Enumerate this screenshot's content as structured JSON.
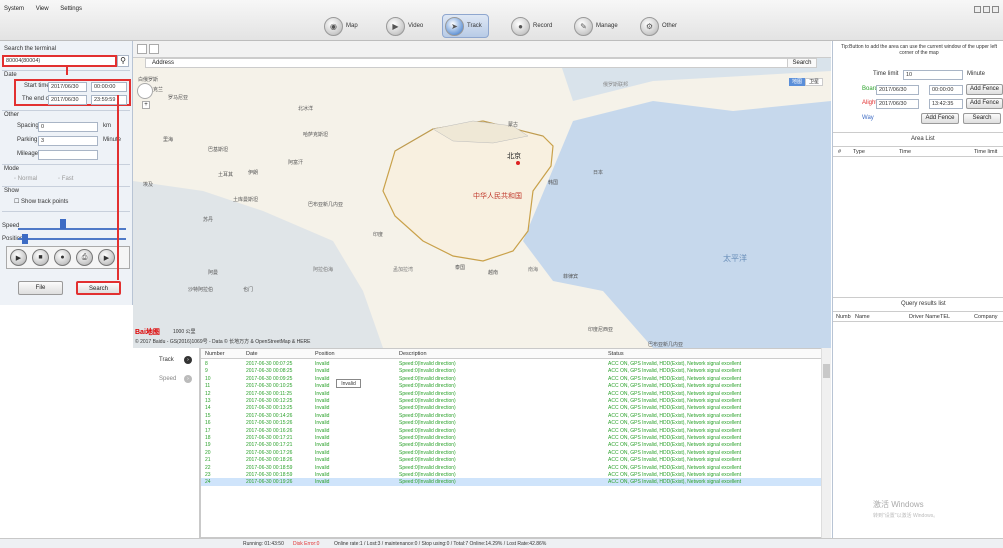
{
  "menu": [
    "System",
    "View",
    "Settings"
  ],
  "nav": {
    "map": "Map",
    "video": "Video",
    "track": "Track",
    "record": "Record",
    "manage": "Manage",
    "other": "Other"
  },
  "left": {
    "search_title": "Search the terminal",
    "terminal_value": "80004(80004)",
    "date_label": "Date",
    "start_label": "Start time",
    "start_date": "2017/06/30",
    "start_time": "00:00:00",
    "end_label": "The end of",
    "end_date": "2017/06/30",
    "end_time": "23:59:59",
    "other_label": "Other",
    "spacing_label": "Spacing",
    "spacing_value": "0",
    "spacing_unit": "km",
    "parking_label": "Parking",
    "parking_value": "3",
    "parking_unit": "Minute",
    "mileage_label": "Mileage",
    "mode_label": "Mode",
    "mode_normal": "Normal",
    "mode_fast": "Fast",
    "show_label": "Show",
    "show_track": "Show track points",
    "speed_label": "Speed",
    "position_label": "Position",
    "file_btn": "File",
    "search_btn": "Search"
  },
  "map": {
    "address_label": "Address",
    "search_label": "Search",
    "copyright": "© 2017 Baidu - GS(2016)1069号 - Data © 长地万方 & OpenStreetMap & HERE",
    "beijing": "北京",
    "china": "中华人民共和国",
    "pacific": "太平洋",
    "labels": [
      "俄罗斯联邦",
      "蒙古",
      "哈萨克斯坦",
      "日本",
      "韩国",
      "印度",
      "泰国",
      "越南",
      "菲律宾",
      "孟加拉湾",
      "南海",
      "印度尼西亚",
      "巴布亚新几内亚",
      "阿富汗",
      "巴基斯坦",
      "伊朗",
      "土耳其",
      "土库曼斯坦",
      "乌兹别克斯坦",
      "阿曼",
      "也门",
      "沙特阿拉伯",
      "阿联酋",
      "埃及",
      "苏丹",
      "埃塞俄比亚",
      "索马里",
      "肯尼亚",
      "白俄罗斯",
      "乌克兰",
      "罗马尼亚",
      "北冰洋",
      "里海",
      "阿拉伯海"
    ],
    "satellite": "卫星",
    "map_btn": "地图",
    "baidu_logo": "Bai地图",
    "scale": "1000 公里"
  },
  "right": {
    "tip": "Tip:Button to add the area can use the current window of the upper left corner of the map",
    "time_limit_label": "Time limit",
    "time_limit_value": "10",
    "time_limit_unit": "Minute",
    "board_label": "Board",
    "board_date": "2017/06/30",
    "board_time": "00:00:00",
    "alight_label": "Alight",
    "alight_date": "2017/06/30",
    "alight_time": "13:42:35",
    "add_fence_1": "Add Fence",
    "add_fence_2": "Add Fence",
    "way_label": "Way",
    "add_fence_3": "Add Fence",
    "search_btn": "Search",
    "area_list": "Area List",
    "area_cols": [
      "#",
      "Type",
      "Time",
      "Time limit"
    ],
    "query_title": "Query results list",
    "query_cols": [
      "Numb",
      "Name",
      "Driver Name",
      "TEL",
      "Company"
    ],
    "watermark_1": "激活 Windows",
    "watermark_2": "转到\"设置\"以激活 Windows。"
  },
  "tabs": {
    "track": "Track",
    "speed": "Speed"
  },
  "grid": {
    "cols": [
      "Number",
      "Date",
      "Position",
      "Description",
      "Status"
    ],
    "tooltip": "Invalid",
    "rows": [
      {
        "n": "8",
        "d": "2017-06-30 00:07:25",
        "p": "Invalid",
        "desc": "Speed:0(Invalid direction)",
        "s": "ACC ON, GPS Invalid, HDD(Exist), Network signal excellent"
      },
      {
        "n": "9",
        "d": "2017-06-30 00:08:25",
        "p": "Invalid",
        "desc": "Speed:0(Invalid direction)",
        "s": "ACC ON, GPS Invalid, HDD(Exist), Network signal excellent"
      },
      {
        "n": "10",
        "d": "2017-06-30 00:09:25",
        "p": "Invalid",
        "desc": "Speed:0(Invalid direction)",
        "s": "ACC ON, GPS Invalid, HDD(Exist), Network signal excellent"
      },
      {
        "n": "11",
        "d": "2017-06-30 00:10:25",
        "p": "Invalid",
        "desc": "Speed:0(Invalid direction)",
        "s": "ACC ON, GPS Invalid, HDD(Exist), Network signal excellent"
      },
      {
        "n": "12",
        "d": "2017-06-30 00:11:25",
        "p": "Invalid",
        "desc": "Speed:0(Invalid direction)",
        "s": "ACC ON, GPS Invalid, HDD(Exist), Network signal excellent"
      },
      {
        "n": "13",
        "d": "2017-06-30 00:12:25",
        "p": "Invalid",
        "desc": "Speed:0(Invalid direction)",
        "s": "ACC ON, GPS Invalid, HDD(Exist), Network signal excellent"
      },
      {
        "n": "14",
        "d": "2017-06-30 00:13:25",
        "p": "Invalid",
        "desc": "Speed:0(Invalid direction)",
        "s": "ACC ON, GPS Invalid, HDD(Exist), Network signal excellent"
      },
      {
        "n": "15",
        "d": "2017-06-30 00:14:26",
        "p": "Invalid",
        "desc": "Speed:0(Invalid direction)",
        "s": "ACC ON, GPS Invalid, HDD(Exist), Network signal excellent"
      },
      {
        "n": "16",
        "d": "2017-06-30 00:15:26",
        "p": "Invalid",
        "desc": "Speed:0(Invalid direction)",
        "s": "ACC ON, GPS Invalid, HDD(Exist), Network signal excellent"
      },
      {
        "n": "17",
        "d": "2017-06-30 00:16:26",
        "p": "Invalid",
        "desc": "Speed:0(Invalid direction)",
        "s": "ACC ON, GPS Invalid, HDD(Exist), Network signal excellent"
      },
      {
        "n": "18",
        "d": "2017-06-30 00:17:21",
        "p": "Invalid",
        "desc": "Speed:0(Invalid direction)",
        "s": "ACC ON, GPS Invalid, HDD(Exist), Network signal excellent"
      },
      {
        "n": "19",
        "d": "2017-06-30 00:17:21",
        "p": "Invalid",
        "desc": "Speed:0(Invalid direction)",
        "s": "ACC ON, GPS Invalid, HDD(Exist), Network signal excellent"
      },
      {
        "n": "20",
        "d": "2017-06-30 00:17:26",
        "p": "Invalid",
        "desc": "Speed:0(Invalid direction)",
        "s": "ACC ON, GPS Invalid, HDD(Exist), Network signal excellent"
      },
      {
        "n": "21",
        "d": "2017-06-30 00:18:26",
        "p": "Invalid",
        "desc": "Speed:0(Invalid direction)",
        "s": "ACC ON, GPS Invalid, HDD(Exist), Network signal excellent"
      },
      {
        "n": "22",
        "d": "2017-06-30 00:18:59",
        "p": "Invalid",
        "desc": "Speed:0(Invalid direction)",
        "s": "ACC ON, GPS Invalid, HDD(Exist), Network signal excellent"
      },
      {
        "n": "23",
        "d": "2017-06-30 00:18:59",
        "p": "Invalid",
        "desc": "Speed:0(Invalid direction)",
        "s": "ACC ON, GPS Invalid, HDD(Exist), Network signal excellent"
      },
      {
        "n": "24",
        "d": "2017-06-30 00:19:26",
        "p": "Invalid",
        "desc": "Speed:0(Invalid direction)",
        "s": "ACC ON, GPS Invalid, HDD(Exist), Network signal excellent"
      }
    ]
  },
  "status": {
    "running": "Running: 01:43:50",
    "disk_error": "Disk Error:0",
    "stats": "Online rate:1 / Lost:3 / maintenance:0 / Stop using:0 / Total:7   Online:14.29% / Lost Rate:42.86%"
  },
  "colors": {
    "accent_red": "#e23030",
    "row_green": "#2aa12a",
    "selected_row": "#cfe4fb"
  },
  "icons": {
    "map": "map-icon",
    "video": "video-icon",
    "track": "track-icon",
    "record": "record-icon",
    "manage": "manage-icon",
    "other": "other-icon"
  }
}
